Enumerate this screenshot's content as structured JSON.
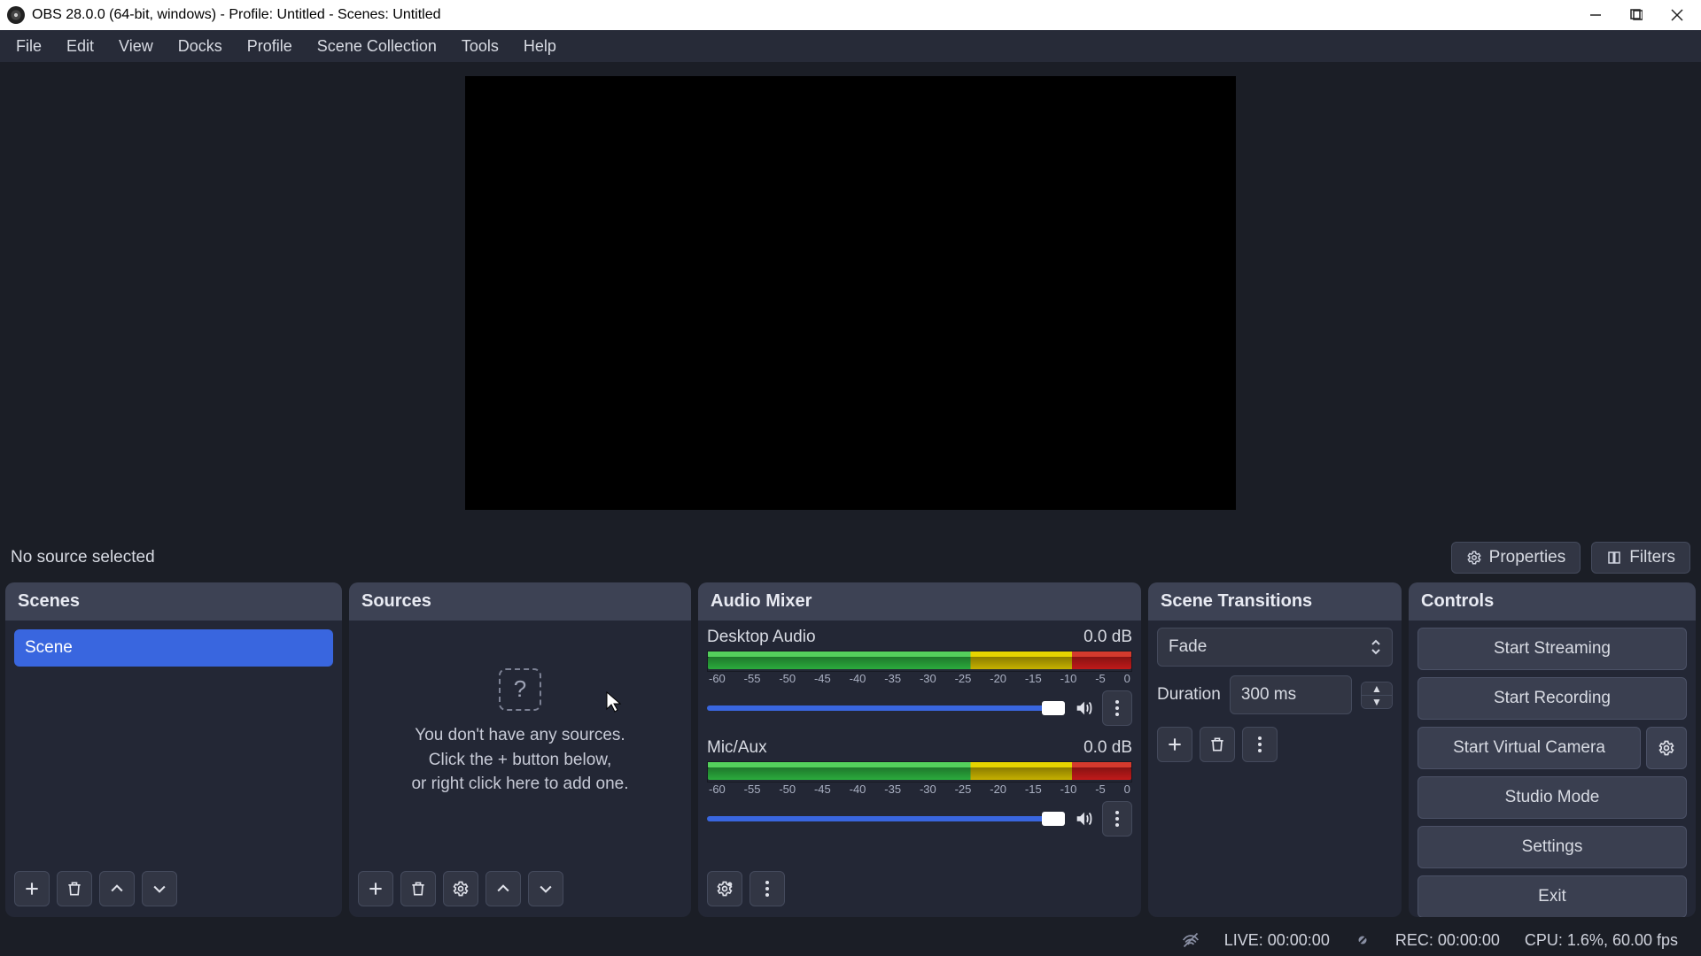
{
  "titlebar": {
    "title": "OBS 28.0.0 (64-bit, windows) - Profile: Untitled - Scenes: Untitled"
  },
  "menubar": {
    "items": [
      "File",
      "Edit",
      "View",
      "Docks",
      "Profile",
      "Scene Collection",
      "Tools",
      "Help"
    ]
  },
  "source_toolbar": {
    "status": "No source selected",
    "properties": "Properties",
    "filters": "Filters"
  },
  "scenes": {
    "title": "Scenes",
    "items": [
      "Scene"
    ]
  },
  "sources": {
    "title": "Sources",
    "empty1": "You don't have any sources.",
    "empty2": "Click the + button below,",
    "empty3": "or right click here to add one."
  },
  "mixer": {
    "title": "Audio Mixer",
    "ticks": [
      "-60",
      "-55",
      "-50",
      "-45",
      "-40",
      "-35",
      "-30",
      "-25",
      "-20",
      "-15",
      "-10",
      "-5",
      "0"
    ],
    "channels": [
      {
        "name": "Desktop Audio",
        "db": "0.0 dB"
      },
      {
        "name": "Mic/Aux",
        "db": "0.0 dB"
      }
    ]
  },
  "transitions": {
    "title": "Scene Transitions",
    "selected": "Fade",
    "duration_label": "Duration",
    "duration_value": "300 ms"
  },
  "controls": {
    "title": "Controls",
    "buttons": {
      "stream": "Start Streaming",
      "record": "Start Recording",
      "vcam": "Start Virtual Camera",
      "studio": "Studio Mode",
      "settings": "Settings",
      "exit": "Exit"
    }
  },
  "statusbar": {
    "live": "LIVE: 00:00:00",
    "rec": "REC: 00:00:00",
    "cpu": "CPU: 1.6%, 60.00 fps"
  }
}
